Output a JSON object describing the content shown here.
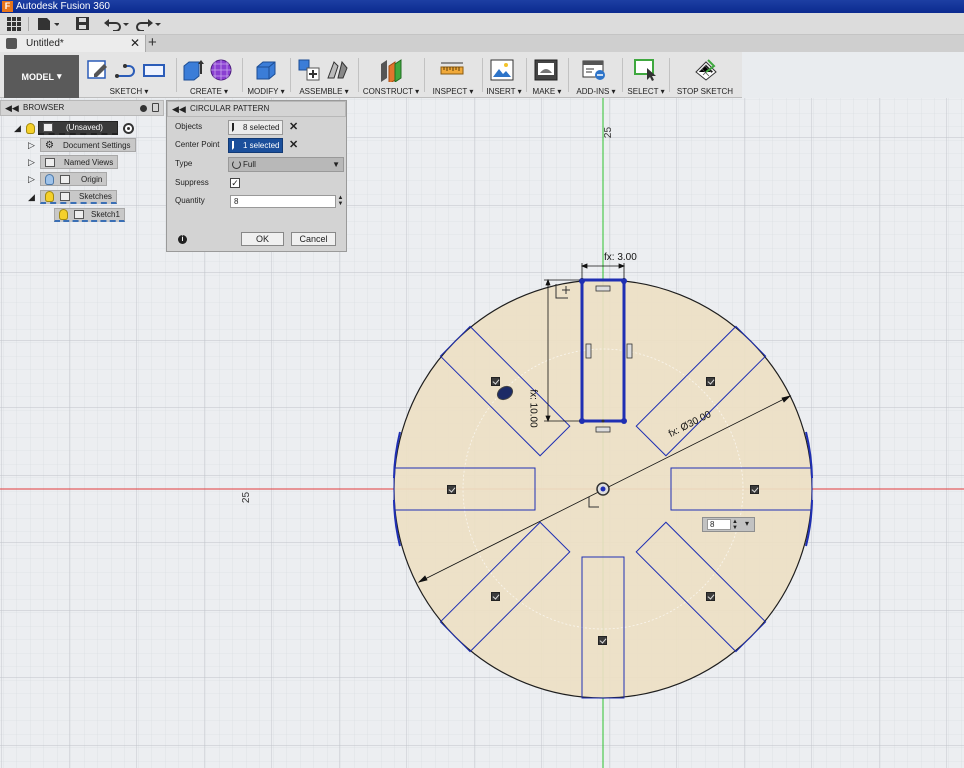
{
  "window": {
    "title": "Autodesk Fusion 360"
  },
  "document_tab": {
    "label": "Untitled*"
  },
  "toolbar": {
    "workspace": "MODEL",
    "groups": [
      {
        "key": "sketch",
        "label": "SKETCH ▾"
      },
      {
        "key": "create",
        "label": "CREATE ▾"
      },
      {
        "key": "modify",
        "label": "MODIFY ▾"
      },
      {
        "key": "assemble",
        "label": "ASSEMBLE ▾"
      },
      {
        "key": "construct",
        "label": "CONSTRUCT ▾"
      },
      {
        "key": "inspect",
        "label": "INSPECT ▾"
      },
      {
        "key": "insert",
        "label": "INSERT ▾"
      },
      {
        "key": "make",
        "label": "MAKE ▾"
      },
      {
        "key": "addins",
        "label": "ADD-INS ▾"
      },
      {
        "key": "select",
        "label": "SELECT ▾"
      },
      {
        "key": "stop_sketch",
        "label": "STOP SKETCH"
      }
    ]
  },
  "browser": {
    "title": "BROWSER",
    "items": [
      {
        "label": "(Unsaved)"
      },
      {
        "label": "Document Settings"
      },
      {
        "label": "Named Views"
      },
      {
        "label": "Origin"
      },
      {
        "label": "Sketches"
      },
      {
        "label": "Sketch1"
      }
    ]
  },
  "dialog": {
    "title": "CIRCULAR PATTERN",
    "objects_label": "Objects",
    "objects_value": "8 selected",
    "center_label": "Center Point",
    "center_value": "1 selected",
    "type_label": "Type",
    "type_value": "Full",
    "suppress_label": "Suppress",
    "suppress_checked": true,
    "quantity_label": "Quantity",
    "quantity_value": "8",
    "ok_label": "OK",
    "cancel_label": "Cancel"
  },
  "canvas": {
    "axis_label_top": "25",
    "axis_label_left": "25",
    "dim_width": "fx: 3.00",
    "dim_height": "fx: 10.00",
    "dim_diameter": "fx: Ø30.00",
    "quantity_widget_value": "8"
  },
  "colors": {
    "sketch_fill": "#ede0c4",
    "profile_line": "#1f2fb3",
    "x_axis": "#e23b3b",
    "y_axis": "#2ec12e",
    "grid": "#c9ccd1"
  }
}
